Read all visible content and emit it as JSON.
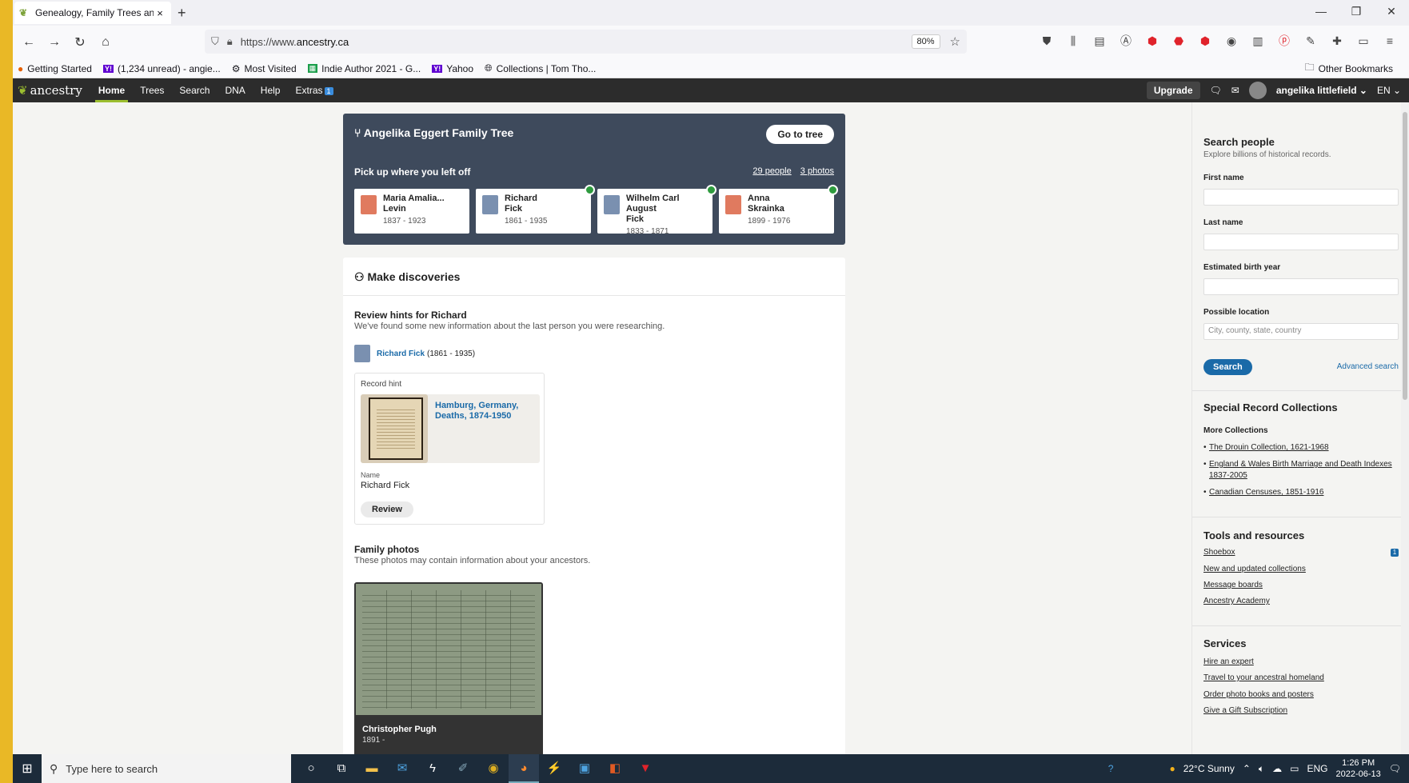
{
  "browser": {
    "tab_title": "Genealogy, Family Trees and Fa",
    "tab_close": "×",
    "new_tab": "+",
    "url_prefix": "https://www.",
    "url_domain": "ancestry.ca",
    "zoom": "80%",
    "bookmarks": [
      {
        "label": "Getting Started",
        "icon": "firefox-icon"
      },
      {
        "label": "(1,234 unread) - angie...",
        "icon": "yahoo-mail-icon"
      },
      {
        "label": "Most Visited",
        "icon": "gear-icon"
      },
      {
        "label": "Indie Author 2021 - G...",
        "icon": "sheets-icon"
      },
      {
        "label": "Yahoo",
        "icon": "yahoo-icon"
      },
      {
        "label": "Collections | Tom Tho...",
        "icon": "globe-icon"
      }
    ],
    "other_bookmarks": "Other Bookmarks"
  },
  "ancestry_nav": {
    "logo": "ancestry",
    "items": [
      "Home",
      "Trees",
      "Search",
      "DNA",
      "Help",
      "Extras"
    ],
    "extras_badge": "1",
    "upgrade": "Upgrade",
    "user": "angelika littlefield",
    "lang": "EN"
  },
  "tree": {
    "title": "Angelika Eggert Family Tree",
    "goto": "Go to tree",
    "pickup": "Pick up where you left off",
    "people_link": "29 people",
    "photos_link": "3 photos",
    "people": [
      {
        "name1": "Maria Amalia...",
        "name2": "Levin",
        "years": "1837 - 1923",
        "gender": "f",
        "badge": false
      },
      {
        "name1": "Richard",
        "name2": "Fick",
        "years": "1861 - 1935",
        "gender": "m",
        "badge": true
      },
      {
        "name1": "Wilhelm Carl August",
        "name2": "Fick",
        "years": "1833 - 1871",
        "gender": "m",
        "badge": true
      },
      {
        "name1": "Anna",
        "name2": "Skrainka",
        "years": "1899 - 1976",
        "gender": "f",
        "badge": true
      }
    ]
  },
  "discoveries": {
    "title": "Make discoveries",
    "hints_title": "Review hints for Richard",
    "hints_sub": "We've found some new information about the last person you were researching.",
    "person_name": "Richard Fick",
    "person_years": "(1861 - 1935)",
    "record_hint_label": "Record hint",
    "record_title": "Hamburg, Germany, Deaths, 1874-1950",
    "name_label": "Name",
    "name_value": "Richard Fick",
    "review": "Review",
    "photos_title": "Family photos",
    "photos_sub": "These photos may contain information about your ancestors.",
    "photo_name": "Christopher Pugh",
    "photo_years": "1891 -"
  },
  "sidebar": {
    "search_title": "Search people",
    "search_sub": "Explore billions of historical records.",
    "first_name": "First name",
    "last_name": "Last name",
    "birth_year": "Estimated birth year",
    "location": "Possible location",
    "location_placeholder": "City, county, state, country",
    "search_btn": "Search",
    "advanced": "Advanced search",
    "special_title": "Special Record Collections",
    "more_collections": "More Collections",
    "collections": [
      "The Drouin Collection, 1621-1968",
      "England & Wales Birth Marriage and Death Indexes 1837-2005",
      "Canadian Censuses, 1851-1916"
    ],
    "tools_title": "Tools and resources",
    "tools": [
      "Shoebox",
      "New and updated collections",
      "Message boards",
      "Ancestry Academy"
    ],
    "shoebox_badge": "1",
    "services_title": "Services",
    "services": [
      "Hire an expert",
      "Travel to your ancestral homeland",
      "Order photo books and posters",
      "Give a Gift Subscription"
    ]
  },
  "taskbar": {
    "search_placeholder": "Type here to search",
    "weather": "22°C  Sunny",
    "lang": "ENG",
    "time": "1:26 PM",
    "date": "2022-06-13"
  }
}
